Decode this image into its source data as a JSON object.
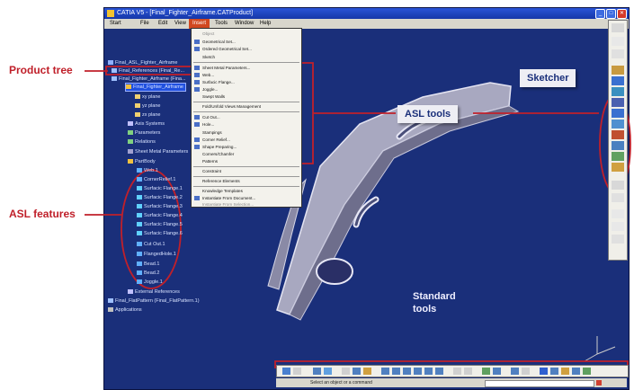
{
  "window": {
    "title": "CATIA V5 - [Final_Fighter_Airframe.CATProduct]",
    "minimize": "_",
    "maximize": "□",
    "close": "✕"
  },
  "menubar": [
    "Start",
    "File",
    "Edit",
    "View",
    "Insert",
    "Tools",
    "Window",
    "Help"
  ],
  "tree": {
    "rows": [
      "Final_ASL_Fighter_Airframe",
      "Final_References (Final_Re...",
      "Final_Fighter_Airframe (Fina...",
      "Final_Fighter_Airframe",
      "xy plane",
      "yz plane",
      "zx plane",
      "Axis Systems",
      "Parameters",
      "Relations",
      "Sheet Metal Parameters",
      "PartBody",
      "Web.1",
      "CornerRelief.1",
      "Surfacic Flange.1",
      "Surfacic Flange.2",
      "Surfacic Flange.3",
      "Surfacic Flange.4",
      "Surfacic Flange.5",
      "Surfacic Flange.6",
      "Cut Out.1",
      "FlangedHole.1",
      "Bead.1",
      "Bead.2",
      "Joggle.1",
      "External References",
      "Final_FlatPattern (Final_FlatPattern.1)",
      "Applications"
    ]
  },
  "menu": {
    "items": [
      "Object",
      "Geometrical Set...",
      "Ordered Geometrical Set...",
      "Sketch",
      "Sheet Metal Parameters...",
      "Web...",
      "Surfacic Flange...",
      "Joggle...",
      "Swept Walls",
      "Fold/Unfold Views Management",
      "Cut Out...",
      "Hole...",
      "Stampings",
      "Corner Relief...",
      "Shape Preparing...",
      "Corners/Chamfer",
      "Patterns",
      "Constraint",
      "Reference Elements",
      "Knowledge Templates",
      "Instantiate From Document...",
      "Instantiate From Selection..."
    ]
  },
  "status": {
    "prompt": "Select an object or a command"
  },
  "annotations": {
    "product_tree": "Product tree",
    "asl_features": "ASL features",
    "asl_tools": "ASL tools",
    "sketcher": "Sketcher",
    "standard_line1": "Standard",
    "standard_line2": "tools"
  },
  "colors": {
    "annotation_red": "#c0202a",
    "viewport_blue": "#1a2f7a",
    "menu_highlight": "#d14820"
  }
}
